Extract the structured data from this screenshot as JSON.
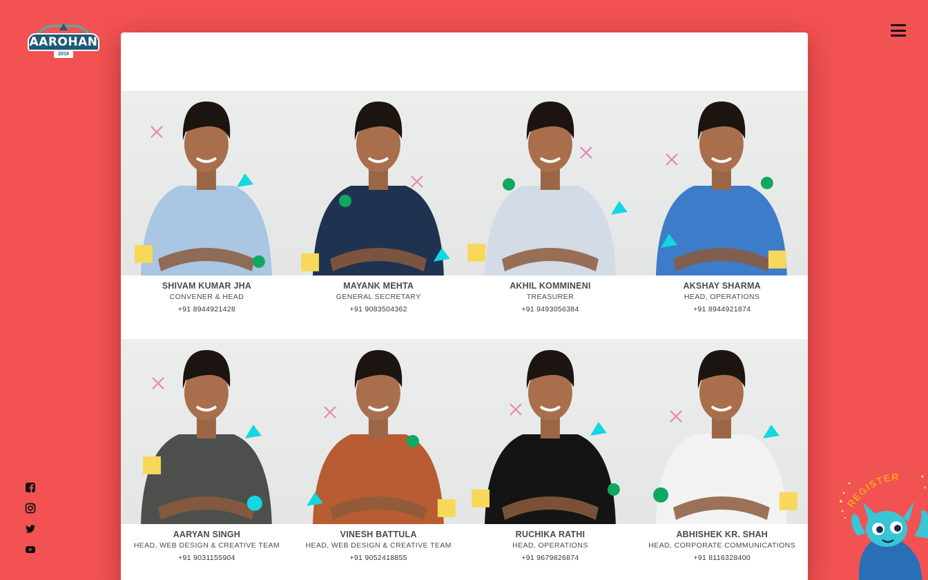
{
  "brand": {
    "logo_text": "AAROHAN",
    "logo_year": "2019"
  },
  "header": {
    "menu_icon": "hamburger-icon"
  },
  "social": [
    {
      "icon": "facebook-icon"
    },
    {
      "icon": "instagram-icon"
    },
    {
      "icon": "twitter-icon"
    },
    {
      "icon": "youtube-icon"
    }
  ],
  "team": [
    {
      "name": "SHIVAM KUMAR JHA",
      "role": "CONVENER & HEAD",
      "phone": "+91 8944921428",
      "shirt": "#a9c6e2"
    },
    {
      "name": "MAYANK MEHTA",
      "role": "GENERAL SECRETARY",
      "phone": "+91 9083504362",
      "shirt": "#1f3350"
    },
    {
      "name": "AKHIL KOMMINENI",
      "role": "TREASURER",
      "phone": "+91 9493056384",
      "shirt": "#d3dbe6"
    },
    {
      "name": "AKSHAY SHARMA",
      "role": "HEAD, OPERATIONS",
      "phone": "+91 8944921874",
      "shirt": "#3d7cc9"
    },
    {
      "name": "AARYAN SINGH",
      "role": "HEAD, WEB DESIGN & CREATIVE TEAM",
      "phone": "+91 9031155904",
      "shirt": "#4d4f4d"
    },
    {
      "name": "VINESH BATTULA",
      "role": "HEAD, WEB DESIGN & CREATIVE TEAM",
      "phone": "+91 9052418855",
      "shirt": "#b85c33"
    },
    {
      "name": "RUCHIKA RATHI",
      "role": "HEAD, OPERATIONS",
      "phone": "+91 9679826874",
      "shirt": "#141414"
    },
    {
      "name": "ABHISHEK KR. SHAH",
      "role": "HEAD, CORPORATE COMMUNICATIONS",
      "phone": "+91 8116328400",
      "shirt": "#f2f2f2"
    }
  ],
  "register": {
    "label": "REGISTER"
  },
  "colors": {
    "background": "#f25252",
    "panel": "#ffffff",
    "accent_yellow": "#f8d85a",
    "accent_green": "#0fa860",
    "accent_cyan": "#12d8e0",
    "accent_pink": "#e887b5"
  }
}
